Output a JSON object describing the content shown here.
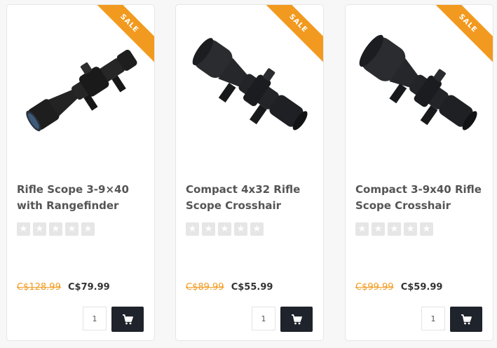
{
  "products": [
    {
      "sale_label": "SALE",
      "title_line1": "Rifle Scope 3-9×40",
      "title_line2": "with Rangefinder",
      "rating_stars": 0,
      "old_price": "C$128.99",
      "new_price": "C$79.99",
      "quantity": "1",
      "image_icon": "rifle-scope-long"
    },
    {
      "sale_label": "SALE",
      "title_line1": "Compact 4x32 Rifle",
      "title_line2": "Scope Crosshair",
      "rating_stars": 0,
      "old_price": "C$89.99",
      "new_price": "C$55.99",
      "quantity": "1",
      "image_icon": "rifle-scope-compact"
    },
    {
      "sale_label": "SALE",
      "title_line1": "Compact 3-9x40 Rifle",
      "title_line2": "Scope Crosshair",
      "rating_stars": 0,
      "old_price": "C$99.99",
      "new_price": "C$59.99",
      "quantity": "1",
      "image_icon": "rifle-scope-compact"
    }
  ],
  "colors": {
    "sale_ribbon": "#f29a1f",
    "old_price": "#f29a1f",
    "cart_button": "#1f232b",
    "star_empty": "#e6e6e6"
  },
  "icons": {
    "star": "star-icon",
    "cart": "cart-icon"
  }
}
